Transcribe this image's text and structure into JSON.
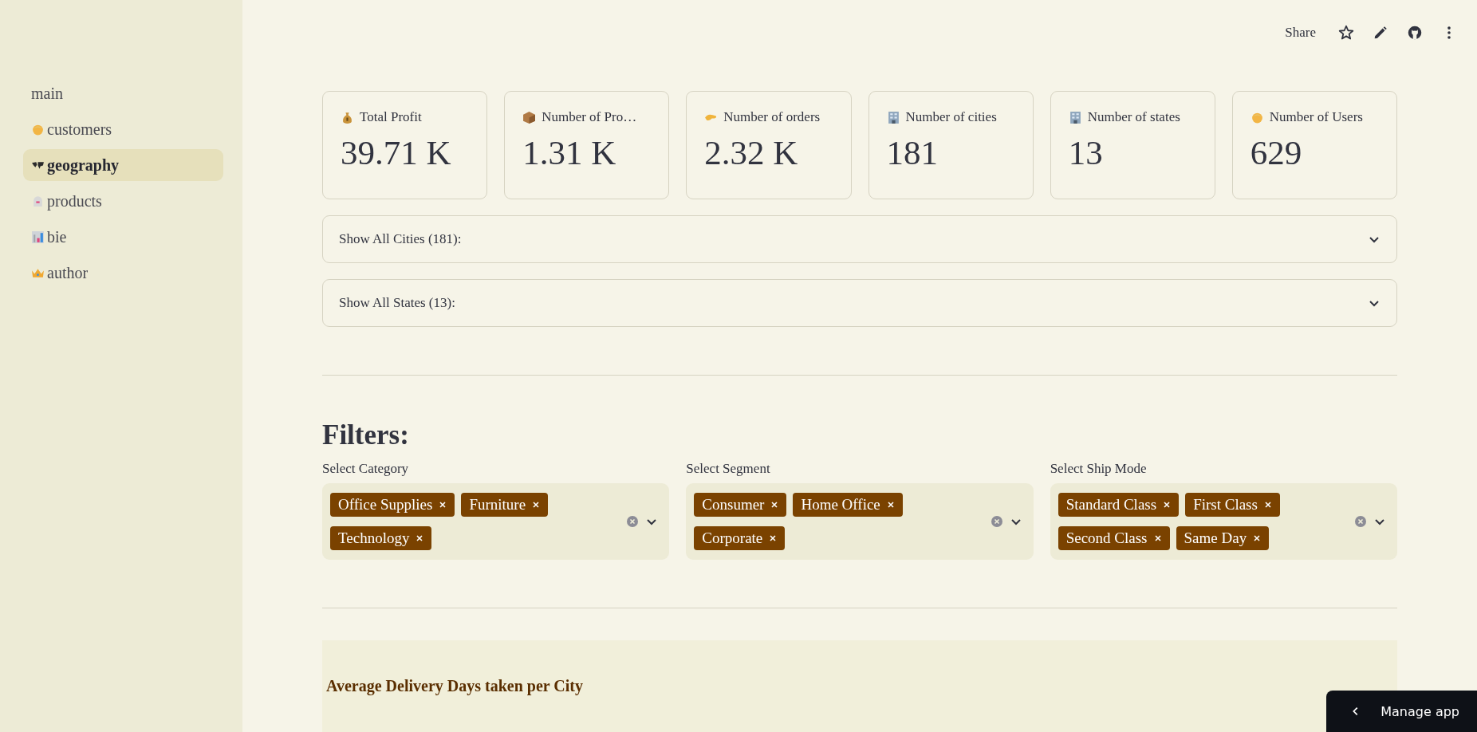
{
  "sidebar": {
    "items": [
      {
        "label": "main",
        "selected": false
      },
      {
        "label": "customers",
        "selected": false
      },
      {
        "label": "geography",
        "selected": true
      },
      {
        "label": "products",
        "selected": false
      },
      {
        "label": "bie",
        "selected": false
      },
      {
        "label": "author",
        "selected": false
      }
    ]
  },
  "toolbar": {
    "share": "Share"
  },
  "metrics": [
    {
      "label": "Total Profit",
      "value": "39.71 K"
    },
    {
      "label": "Number of Pro…",
      "value": "1.31 K"
    },
    {
      "label": "Number of orders",
      "value": "2.32 K"
    },
    {
      "label": "Number of cities",
      "value": "181"
    },
    {
      "label": "Number of states",
      "value": "13"
    },
    {
      "label": "Number of Users",
      "value": "629"
    }
  ],
  "expanders": [
    {
      "label": "Show All Cities (181):",
      "expanded": false
    },
    {
      "label": "Show All States (13):",
      "expanded": false
    }
  ],
  "filters": {
    "title": "Filters:",
    "selects": [
      {
        "label": "Select Category",
        "tags": [
          "Office Supplies",
          "Furniture",
          "Technology"
        ]
      },
      {
        "label": "Select Segment",
        "tags": [
          "Consumer",
          "Home Office",
          "Corporate"
        ]
      },
      {
        "label": "Select Ship Mode",
        "tags": [
          "Standard Class",
          "First Class",
          "Second Class",
          "Same Day"
        ]
      }
    ]
  },
  "chart_section": {
    "title": "Average Delivery Days taken per City"
  },
  "manage_app": {
    "label": "Manage app"
  }
}
